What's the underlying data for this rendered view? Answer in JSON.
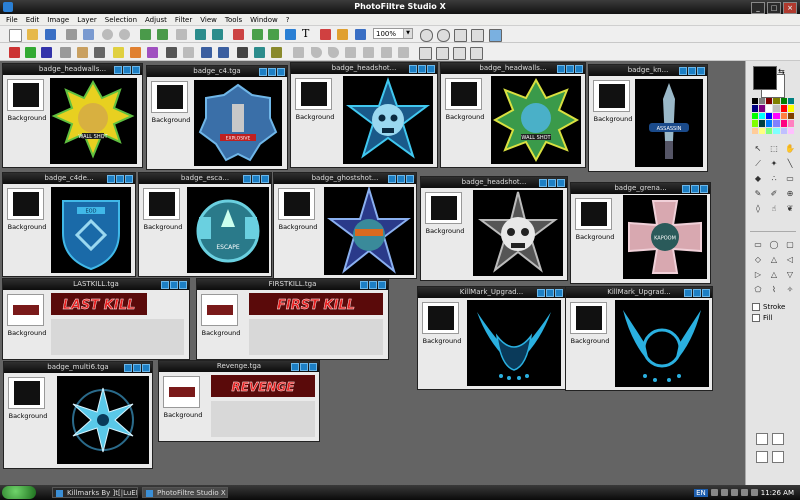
{
  "app": {
    "title": "PhotoFiltre Studio X"
  },
  "window_controls": {
    "minimize": "_",
    "maximize": "□",
    "close": "×"
  },
  "menu": [
    "File",
    "Edit",
    "Image",
    "Layer",
    "Selection",
    "Adjust",
    "Filter",
    "View",
    "Tools",
    "Window",
    "?"
  ],
  "toolbar": {
    "zoom_value": "100%",
    "text_tool_glyph": "T"
  },
  "layer_label": "Background",
  "image_windows": [
    {
      "title": "badge_headwalls...",
      "canvas_text": "WALL SHOT"
    },
    {
      "title": "badge_c4.tga",
      "canvas_text": "EXPLOSIVE"
    },
    {
      "title": "badge_headshot...",
      "canvas_text": ""
    },
    {
      "title": "badge_headwalls...",
      "canvas_text": "WALL SHOT"
    },
    {
      "title": "badge_kn...",
      "canvas_text": "ASSASSIN"
    },
    {
      "title": "badge_c4de...",
      "canvas_text": "EOD"
    },
    {
      "title": "badge_esca...",
      "canvas_text": "ESCAPE"
    },
    {
      "title": "badge_ghostshot...",
      "canvas_text": ""
    },
    {
      "title": "badge_headshot...",
      "canvas_text": ""
    },
    {
      "title": "badge_grena...",
      "canvas_text": "KAPOOM"
    },
    {
      "title": "LASTKILL.tga",
      "canvas_text": "LAST KILL"
    },
    {
      "title": "FIRSTKILL.tga",
      "canvas_text": "FIRST KILL"
    },
    {
      "title": "KillMark_Upgrad...",
      "canvas_text": ""
    },
    {
      "title": "KillMark_Upgrad...",
      "canvas_text": ""
    },
    {
      "title": "badge_multi6.tga",
      "canvas_text": ""
    },
    {
      "title": "Revenge.tga",
      "canvas_text": "REVENGE"
    }
  ],
  "tools_panel": {
    "stroke_label": "Stroke",
    "fill_label": "Fill",
    "swap_glyph": "⇆",
    "palette": [
      "#000000",
      "#808080",
      "#800000",
      "#808000",
      "#008000",
      "#008080",
      "#000080",
      "#800080",
      "#ffffff",
      "#c0c0c0",
      "#ff0000",
      "#ffff00",
      "#00ff00",
      "#00ffff",
      "#0000ff",
      "#ff00ff",
      "#ff8040",
      "#804000",
      "#80ff00",
      "#004040",
      "#0080ff",
      "#8080ff",
      "#ff0080",
      "#ff80c0",
      "#ffcc99",
      "#ffff80",
      "#80ff80",
      "#80ffff",
      "#c0c0ff",
      "#ffc0ff"
    ]
  },
  "colors": {
    "fg": "#000000",
    "bg": "#ffffff",
    "accent": "#1d7fc4"
  },
  "taskbar": {
    "tasks": [
      {
        "label": "Killmarks By ]t[|LuEDe..."
      },
      {
        "label": "PhotoFiltre Studio X"
      }
    ],
    "tray_lang": "EN",
    "clock": "11:26 AM"
  }
}
